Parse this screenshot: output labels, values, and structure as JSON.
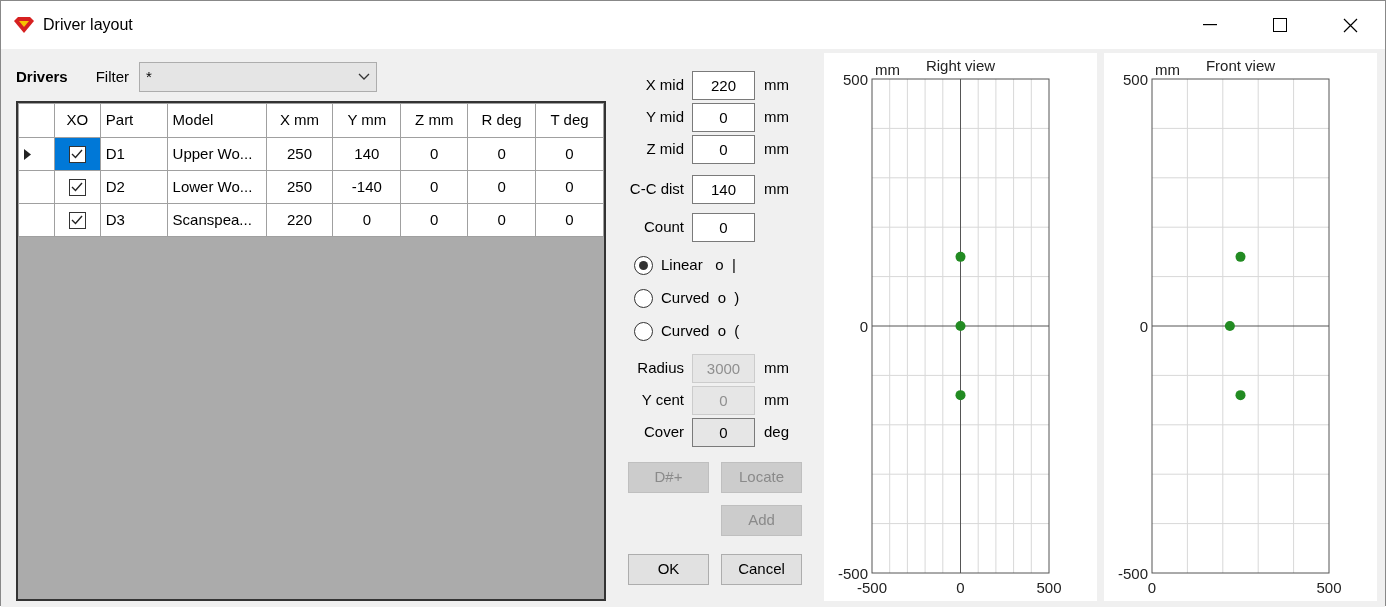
{
  "window": {
    "title": "Driver layout"
  },
  "drivers_label": "Drivers",
  "filter": {
    "label": "Filter",
    "value": "*"
  },
  "table": {
    "checkbox_column": "XO",
    "columns": [
      "Part",
      "Model",
      "X mm",
      "Y mm",
      "Z mm",
      "R deg",
      "T deg"
    ],
    "rows": [
      {
        "selected": true,
        "checked": true,
        "cells": [
          "D1",
          "Upper Wo...",
          "250",
          "140",
          "0",
          "0",
          "0"
        ]
      },
      {
        "selected": false,
        "checked": true,
        "cells": [
          "D2",
          "Lower Wo...",
          "250",
          "-140",
          "0",
          "0",
          "0"
        ]
      },
      {
        "selected": false,
        "checked": true,
        "cells": [
          "D3",
          "Scanspea...",
          "220",
          "0",
          "0",
          "0",
          "0"
        ]
      }
    ]
  },
  "form": [
    {
      "kind": "field",
      "label": "X mid",
      "value": "220",
      "unit": "mm",
      "disabled": false,
      "read_only": false
    },
    {
      "kind": "field",
      "label": "Y mid",
      "value": "0",
      "unit": "mm",
      "disabled": false,
      "read_only": false
    },
    {
      "kind": "field",
      "label": "Z mid",
      "value": "0",
      "unit": "mm",
      "disabled": false,
      "read_only": false
    },
    {
      "kind": "field",
      "label": "C-C dist",
      "value": "140",
      "unit": "mm",
      "disabled": false,
      "read_only": false
    },
    {
      "kind": "field",
      "label": "Count",
      "value": "0",
      "disabled": false,
      "read_only": false
    },
    {
      "kind": "radio",
      "label": "Linear   o  |",
      "selected": true
    },
    {
      "kind": "radio",
      "label": "Curved  o  )",
      "selected": false
    },
    {
      "kind": "radio",
      "label": "Curved  o  (",
      "selected": false
    },
    {
      "kind": "field",
      "label": "Radius",
      "value": "3000",
      "unit": "mm",
      "disabled": true,
      "read_only": true
    },
    {
      "kind": "field",
      "label": "Y cent",
      "value": "0",
      "unit": "mm",
      "disabled": true,
      "read_only": true
    },
    {
      "kind": "field",
      "label": "Cover",
      "value": "0",
      "unit": "deg",
      "disabled": false,
      "read_only": true
    }
  ],
  "button_rows": [
    [
      {
        "label": "D#+",
        "disabled": true
      },
      {
        "label": "Locate",
        "disabled": true
      }
    ],
    [
      {
        "label": "Add",
        "disabled": true
      }
    ],
    [
      {
        "label": "OK",
        "disabled": false
      },
      {
        "label": "Cancel",
        "disabled": false
      }
    ]
  ],
  "charts": [
    {
      "chart_data": {
        "type": "scatter",
        "title": "Right view",
        "ylabel": "mm",
        "x": [
          0,
          0,
          0
        ],
        "series": [
          {
            "color": "#228b22",
            "values": [
              140,
              0,
              -140
            ]
          }
        ],
        "xlim": [
          -500,
          500
        ],
        "ylim": [
          -500,
          500
        ],
        "xticks": [
          -500,
          0,
          500
        ],
        "yticks": [
          -500,
          0,
          500
        ]
      }
    },
    {
      "chart_data": {
        "type": "scatter",
        "title": "Front view",
        "ylabel": "mm",
        "x": [
          250,
          220,
          250
        ],
        "series": [
          {
            "color": "#228b22",
            "values": [
              140,
              0,
              -140
            ]
          }
        ],
        "xlim": [
          0,
          500
        ],
        "ylim": [
          -500,
          500
        ],
        "xticks": [
          0,
          500
        ],
        "yticks": [
          -500,
          0,
          500
        ]
      }
    }
  ]
}
